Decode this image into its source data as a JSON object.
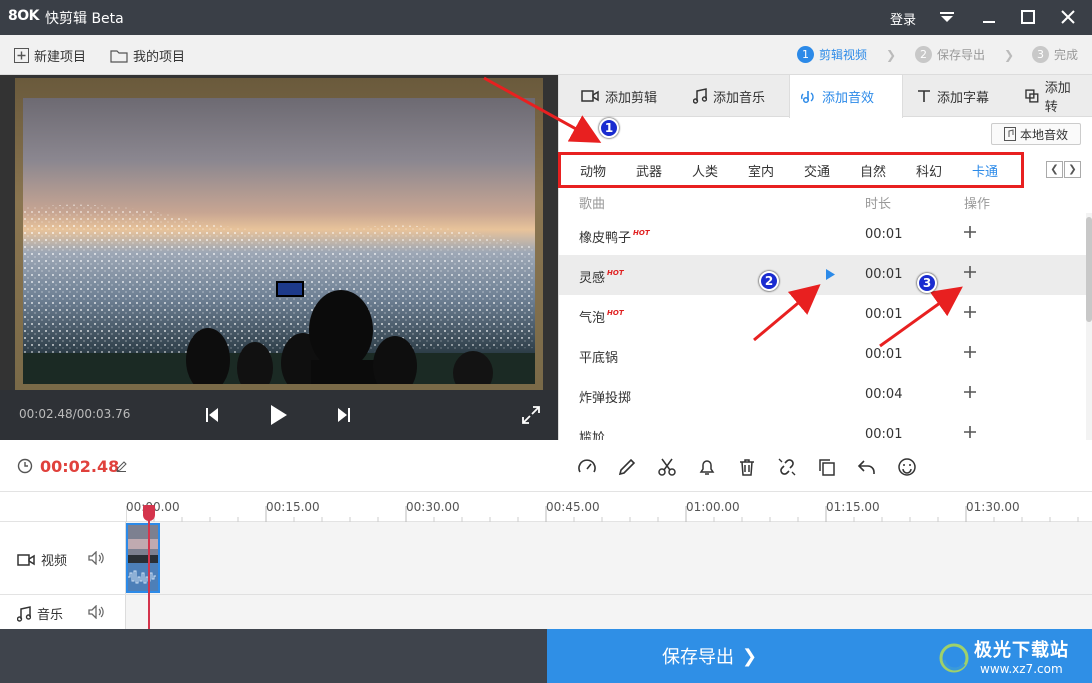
{
  "titlebar": {
    "app_name": "快剪辑 Beta",
    "logo": "8OK",
    "login": "登录"
  },
  "toolbar": {
    "new_project": "新建项目",
    "my_projects": "我的项目"
  },
  "steps": [
    {
      "num": "1",
      "label": "剪辑视频"
    },
    {
      "num": "2",
      "label": "保存导出"
    },
    {
      "num": "3",
      "label": "完成"
    }
  ],
  "player": {
    "time": "00:02.48/00:03.76"
  },
  "tabs": [
    {
      "label": "添加剪辑",
      "icon": "video-camera-icon"
    },
    {
      "label": "添加音乐",
      "icon": "music-note-icon"
    },
    {
      "label": "添加音效",
      "icon": "sound-effect-icon"
    },
    {
      "label": "添加字幕",
      "icon": "text-icon"
    },
    {
      "label": "添加转",
      "icon": "transition-icon"
    }
  ],
  "sfx": {
    "local_button": "本地音效",
    "categories": [
      "动物",
      "武器",
      "人类",
      "室内",
      "交通",
      "自然",
      "科幻",
      "卡通"
    ],
    "active_category": "卡通",
    "columns": {
      "name": "歌曲",
      "duration": "时长",
      "action": "操作"
    },
    "hot_label": "HOT",
    "rows": [
      {
        "name": "橡皮鸭子",
        "hot": true,
        "duration": "00:01"
      },
      {
        "name": "灵感",
        "hot": true,
        "duration": "00:01"
      },
      {
        "name": "气泡",
        "hot": true,
        "duration": "00:01"
      },
      {
        "name": "平底锅",
        "hot": false,
        "duration": "00:01"
      },
      {
        "name": "炸弹投掷",
        "hot": false,
        "duration": "00:04"
      },
      {
        "name": "尴尬",
        "hot": false,
        "duration": "00:01"
      }
    ]
  },
  "timeline": {
    "current_time": "00:02.48",
    "ruler": [
      "00:00.00",
      "00:15.00",
      "00:30.00",
      "00:45.00",
      "01:00.00",
      "01:15.00",
      "01:30.00"
    ],
    "tracks": {
      "video": "视频",
      "music": "音乐"
    }
  },
  "export_button": "保存导出",
  "annotations": [
    "1",
    "2",
    "3"
  ],
  "watermark": {
    "name": "极光下载站",
    "url": "www.xz7.com"
  },
  "colors": {
    "accent": "#2c8ae8",
    "time_red": "#e0413c",
    "annotation_red": "#e82020",
    "titlebar": "#3a3f47"
  }
}
